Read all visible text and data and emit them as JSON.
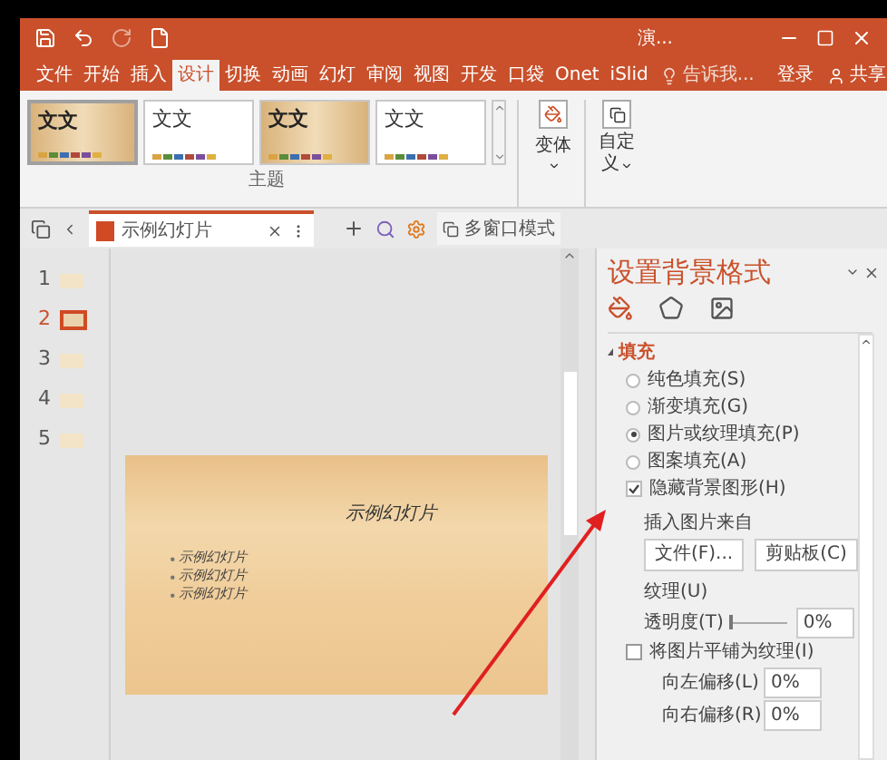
{
  "window": {
    "title": "演..."
  },
  "ribbon_tabs": [
    {
      "label": "文件",
      "selected": false
    },
    {
      "label": "开始",
      "selected": false
    },
    {
      "label": "插入",
      "selected": false
    },
    {
      "label": "设计",
      "selected": true
    },
    {
      "label": "切换",
      "selected": false
    },
    {
      "label": "动画",
      "selected": false
    },
    {
      "label": "幻灯",
      "selected": false
    },
    {
      "label": "审阅",
      "selected": false
    },
    {
      "label": "视图",
      "selected": false
    },
    {
      "label": "开发",
      "selected": false
    },
    {
      "label": "口袋",
      "selected": false
    },
    {
      "label": "Onet",
      "selected": false
    },
    {
      "label": "iSlid",
      "selected": false
    }
  ],
  "tell_me": {
    "placeholder": "告诉我..."
  },
  "login": "登录",
  "share": "共享",
  "themes": [
    {
      "label": "文文",
      "kind": "wood",
      "selected": true
    },
    {
      "label": "文文",
      "kind": "white",
      "selected": false
    },
    {
      "label": "文文",
      "kind": "wood",
      "selected": false
    },
    {
      "label": "文文",
      "kind": "white",
      "selected": false
    }
  ],
  "theme_group": "主题",
  "variants_button": "变体",
  "customize_button": [
    "自定",
    "义"
  ],
  "doc_tab": {
    "title": "示例幻灯片"
  },
  "multi_window": "多窗口模式",
  "slides": [
    {
      "number": "1",
      "selected": false
    },
    {
      "number": "2",
      "selected": true
    },
    {
      "number": "3",
      "selected": false
    },
    {
      "number": "4",
      "selected": false
    },
    {
      "number": "5",
      "selected": false
    }
  ],
  "slide": {
    "title": "示例幻灯片",
    "bullets": [
      "示例幻灯片",
      "示例幻灯片",
      "示例幻灯片"
    ]
  },
  "pane": {
    "title": "设置背景格式",
    "section": {
      "label": "填充",
      "expanded": true
    },
    "fill_options": [
      {
        "label": "纯色填充(S)",
        "selected": false
      },
      {
        "label": "渐变填充(G)",
        "selected": false
      },
      {
        "label": "图片或纹理填充(P)",
        "selected": true
      },
      {
        "label": "图案填充(A)",
        "selected": false
      }
    ],
    "hide_graphics": {
      "label": "隐藏背景图形(H)",
      "checked": true
    },
    "insert_from": "插入图片来自",
    "buttons": [
      "文件(F)...",
      "剪贴板(C)"
    ],
    "texture": "纹理(U)",
    "transparency": {
      "label": "透明度(T)",
      "level": 0,
      "value": "0%"
    },
    "tile": {
      "label": "将图片平铺为纹理(I)",
      "checked": false
    },
    "offsets": [
      {
        "label": "向左偏移(L)",
        "value": "0%"
      },
      {
        "label": "向右偏移(R)",
        "value": "0%"
      }
    ]
  }
}
